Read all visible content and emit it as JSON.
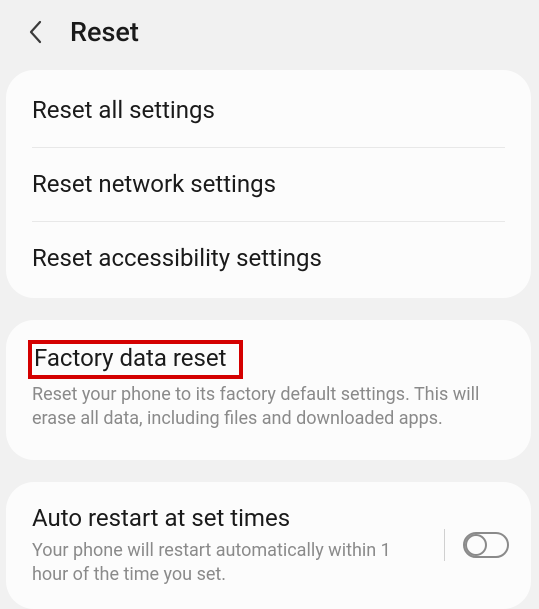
{
  "header": {
    "title": "Reset"
  },
  "group1": {
    "items": [
      {
        "label": "Reset all settings"
      },
      {
        "label": "Reset network settings"
      },
      {
        "label": "Reset accessibility settings"
      }
    ]
  },
  "group2": {
    "title": "Factory data reset",
    "desc": "Reset your phone to its factory default settings. This will erase all data, including files and downloaded apps."
  },
  "group3": {
    "title": "Auto restart at set times",
    "desc": "Your phone will restart automatically within 1 hour of the time you set.",
    "toggle": false
  }
}
